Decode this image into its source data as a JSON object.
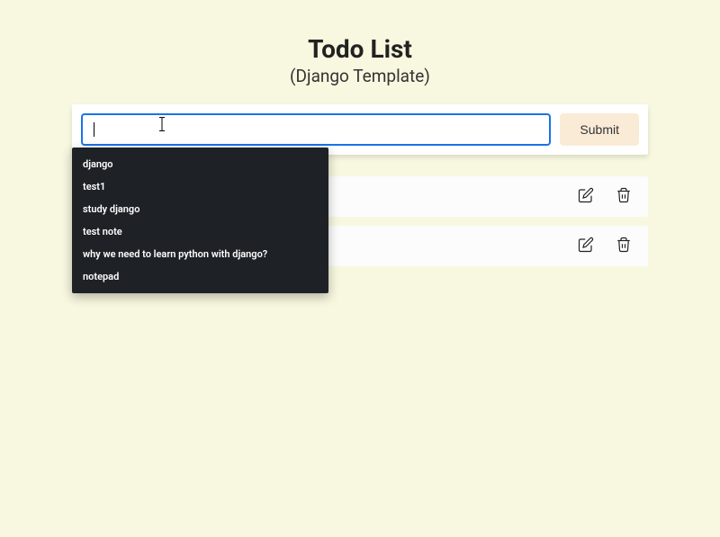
{
  "header": {
    "title": "Todo List",
    "subtitle": "(Django Template)"
  },
  "input": {
    "value": "",
    "placeholder": ""
  },
  "submit_label": "Submit",
  "autocomplete": {
    "items": [
      "django",
      "test1",
      "study django",
      "test note",
      "why we need to learn python with django?",
      "notepad"
    ]
  },
  "todos": [
    {
      "text": ""
    },
    {
      "text": ""
    }
  ]
}
